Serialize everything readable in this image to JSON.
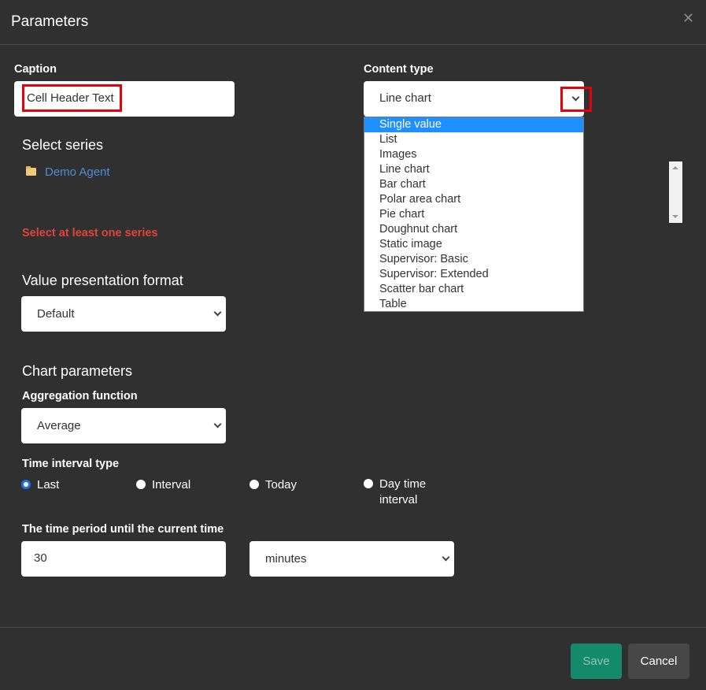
{
  "dialog": {
    "title": "Parameters",
    "close_icon": "close-icon"
  },
  "caption": {
    "label": "Caption",
    "value": "Cell Header Text"
  },
  "content_type": {
    "label": "Content type",
    "value": "Line chart",
    "options": [
      "Single value",
      "List",
      "Images",
      "Line chart",
      "Bar chart",
      "Polar area chart",
      "Pie chart",
      "Doughnut chart",
      "Static image",
      "Supervisor: Basic",
      "Supervisor: Extended",
      "Scatter bar chart",
      "Table"
    ],
    "highlighted_option": "Single value"
  },
  "series": {
    "title": "Select series",
    "items": [
      {
        "label": "Demo Agent",
        "icon": "folder-icon"
      }
    ],
    "error": "Select at least one series"
  },
  "value_format": {
    "title": "Value presentation format",
    "value": "Default"
  },
  "chart_params": {
    "title": "Chart parameters",
    "aggregation_label": "Aggregation function",
    "aggregation_value": "Average",
    "interval_type_label": "Time interval type",
    "interval_options": [
      {
        "label": "Last",
        "checked": true
      },
      {
        "label": "Interval",
        "checked": false
      },
      {
        "label": "Today",
        "checked": false
      },
      {
        "label": "Day time interval",
        "checked": false
      }
    ],
    "period_label": "The time period until the current time",
    "period_value": "30",
    "period_unit": "minutes"
  },
  "footer": {
    "save_label": "Save",
    "cancel_label": "Cancel"
  },
  "colors": {
    "background": "#303030",
    "accent_selected": "#1e90ff",
    "error": "#e0443a",
    "link": "#4a8fd8",
    "save_button": "#148a6b",
    "cancel_button": "#474747",
    "highlight_box": "#e8000b"
  }
}
